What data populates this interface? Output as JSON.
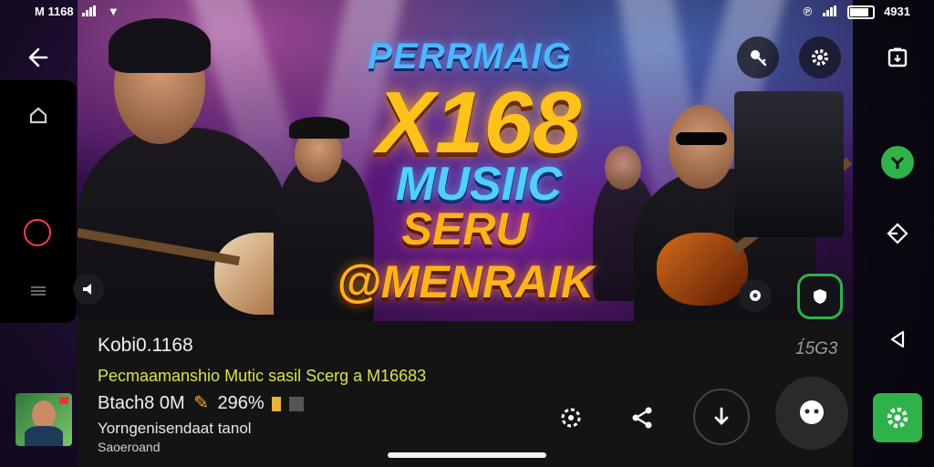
{
  "status_bar": {
    "left_text": "M 1168",
    "right_text": "4931"
  },
  "poster": {
    "line1": "PERRMAIG",
    "line2": "X168",
    "line3": "MUSIIC",
    "line4": "SERU @MENRAIK"
  },
  "video": {
    "channel": "Kobi0.1168",
    "duration": "1́5G3",
    "title": "Pecmaamanshio Mutic sasil Scerg a M16683",
    "stats": "Btach8 0M",
    "stat_value": "296%",
    "desc_line1": "Yorngenisendaat tanol",
    "desc_line2": "Saoeroand"
  },
  "icons": {
    "back": "back-arrow-icon",
    "key": "key-icon",
    "settings": "gear-icon",
    "clipboard": "clipboard-icon",
    "home": "home-icon",
    "record": "record-circle-icon",
    "menu": "menu-lines-icon",
    "volume": "speaker-icon",
    "shield": "shield-icon",
    "effects": "sparkle-icon",
    "share": "share-icon",
    "download": "download-icon",
    "bubble": "bubble-icon",
    "green_settings": "green-gear-icon",
    "play_triangle": "play-back-triangle-icon",
    "diamond": "diamond-icon",
    "game_logo": "green-logo-icon"
  },
  "colors": {
    "accent_green": "#2fb24a",
    "accent_red": "#ff3b4f",
    "text_yellow": "#d9e34a"
  }
}
